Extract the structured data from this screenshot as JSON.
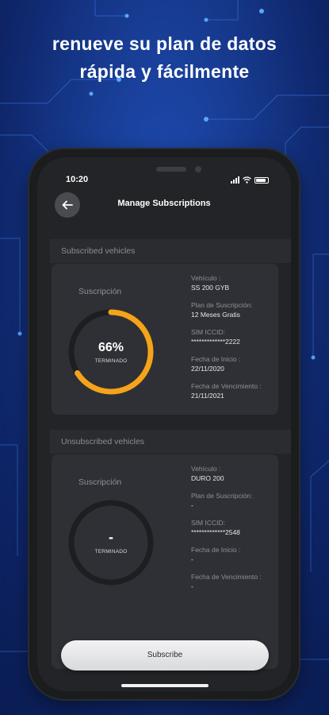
{
  "promo": {
    "line1": "renueve su plan de datos",
    "line2": "rápida y fácilmente"
  },
  "status_bar": {
    "time": "10:20"
  },
  "header": {
    "title": "Manage Subscriptions"
  },
  "sections": {
    "subscribed": "Subscribed vehicles",
    "unsubscribed": "Unsubscribed vehicles"
  },
  "subscribed_card": {
    "subscription_label": "Suscripción",
    "progress_text": "66%",
    "progress_fraction": 0.66,
    "progress_caption": "TERMINADO",
    "fields": [
      {
        "label": "Vehículo :",
        "value": "SS 200 GYB"
      },
      {
        "label": "Plan de Suscripción:",
        "value": "12 Meses Gratis"
      },
      {
        "label": "SIM ICCID:",
        "value": "*************2222"
      },
      {
        "label": "Fecha de Inicio :",
        "value": "22/11/2020"
      },
      {
        "label": "Fecha de Vencimiento :",
        "value": "21/11/2021"
      }
    ]
  },
  "unsubscribed_card": {
    "subscription_label": "Suscripción",
    "progress_text": "-",
    "progress_caption": "TERMINADO",
    "fields": [
      {
        "label": "Vehículo :",
        "value": "DURO 200"
      },
      {
        "label": "Plan de Suscripción:",
        "value": "-"
      },
      {
        "label": "SIM ICCID:",
        "value": "*************2548"
      },
      {
        "label": "Fecha de Inicio :",
        "value": "-"
      },
      {
        "label": "Fecha de Vencimiento :",
        "value": "-"
      }
    ]
  },
  "actions": {
    "subscribe_label": "Subscribe"
  },
  "colors": {
    "accent": "#f5a31a",
    "ring_track": "#1d1e21",
    "background": "#173a8f",
    "screen": "#232427"
  },
  "icons": {
    "back": "arrow-left-icon",
    "signal": "signal-icon",
    "wifi": "wifi-icon",
    "battery": "battery-icon"
  }
}
